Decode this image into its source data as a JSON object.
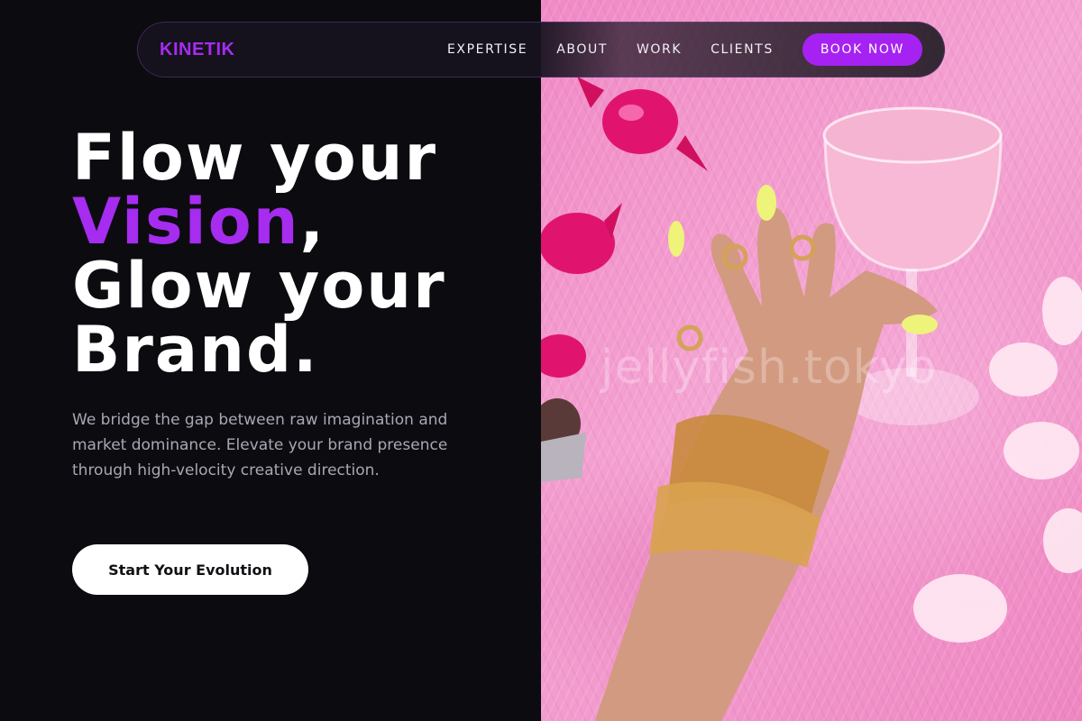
{
  "nav": {
    "logo": "KINETIK",
    "links": [
      "EXPERTISE",
      "ABOUT",
      "WORK",
      "CLIENTS"
    ],
    "book_label": "BOOK NOW"
  },
  "hero": {
    "line1": "Flow your",
    "line2_accent": "Vision",
    "line2_rest": ",",
    "line3": "Glow your",
    "line4": "Brand.",
    "description": "We bridge the gap between raw imagination and market dominance. Elevate your brand presence through high-velocity creative direction.",
    "cta_label": "Start Your Evolution"
  },
  "image": {
    "watermark": "jellyfish.tokyo"
  },
  "colors": {
    "accent": "#a62cf0",
    "background": "#0c0b10",
    "pink": "#f4a3d2"
  }
}
